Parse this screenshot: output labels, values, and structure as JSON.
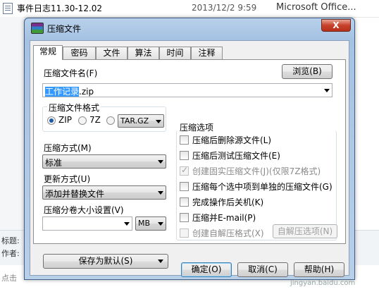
{
  "background": {
    "file_name": "事件日志11.30-12.02",
    "file_date": "2013/12/2 9:59",
    "file_type": "Microsoft Office...",
    "meta_title_label": "标题:",
    "meta_author_label": "作者:",
    "hint_text": "点击",
    "watermark": "jingyan.baidu.com"
  },
  "dialog": {
    "title": "压缩文件",
    "close_label": "X",
    "tabs": [
      "常规",
      "密码",
      "文件",
      "算法",
      "时间",
      "注释"
    ],
    "active_tab": "常规",
    "archive_name_label": "压缩文件名(F)",
    "browse_label": "浏览(B)",
    "archive_name_selected": "工作记录",
    "archive_name_ext": ".zip",
    "format_group_label": "压缩文件格式",
    "format_zip": "ZIP",
    "format_7z": "7Z",
    "format_tar_value": "TAR.GZ",
    "method_label": "压缩方式(M)",
    "method_value": "标准",
    "update_label": "更新方式(U)",
    "update_value": "添加并替换文件",
    "split_label": "压缩分卷大小设置(V)",
    "split_value": "",
    "split_unit": "MB",
    "save_default_label": "保存为默认(S)",
    "options_group_label": "压缩选项",
    "options": [
      {
        "label": "压缩后删除源文件(L)",
        "checked": false,
        "disabled": false
      },
      {
        "label": "压缩后测试压缩文件(E)",
        "checked": false,
        "disabled": false
      },
      {
        "label": "创建固实压缩文件(J)(仅限7Z格式)",
        "checked": true,
        "disabled": true
      },
      {
        "label": "压缩每个选中项到单独的压缩文件(G)",
        "checked": false,
        "disabled": false
      },
      {
        "label": "完成操作后关机(K)",
        "checked": false,
        "disabled": false
      },
      {
        "label": "压缩并E-mail(P)",
        "checked": false,
        "disabled": false
      },
      {
        "label": "创建自解压格式(X)",
        "checked": false,
        "disabled": true
      }
    ],
    "sfx_options_label": "自解压选项(N)",
    "ok_label": "确定(O)",
    "cancel_label": "取消(C)",
    "help_label": "帮助(H)"
  }
}
